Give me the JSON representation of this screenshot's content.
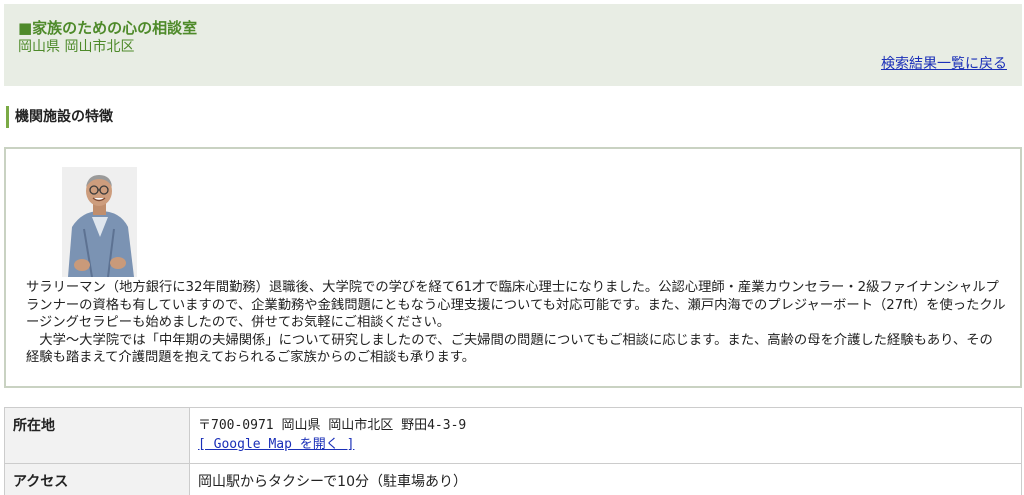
{
  "header": {
    "facility_name": "■家族のための心の相談室",
    "location": "岡山県 岡山市北区",
    "back_link": "検索結果一覧に戻る"
  },
  "features": {
    "heading": "機関施設の特徴",
    "paragraphs": [
      "サラリーマン（地方銀行に32年間勤務）退職後、大学院での学びを経て61才で臨床心理士になりました。公認心理師・産業カウンセラー・2級ファイナンシャルプランナーの資格も有していますので、企業勤務や金銭問題にともなう心理支援についても対応可能です。また、瀬戸内海でのプレジャーボート（27ft）を使ったクルージングセラピーも始めましたので、併せてお気軽にご相談ください。",
      "　大学～大学院では「中年期の夫婦関係」について研究しましたので、ご夫婦間の問題についてもご相談に応じます。また、高齢の母を介護した経験もあり、その経験も踏まえて介護問題を抱えておられるご家族からのご相談も承ります。"
    ]
  },
  "info": {
    "address_label": "所在地",
    "address": "〒700-0971 岡山県 岡山市北区 野田4-3-9",
    "map_link": "[ Google Map を開く ]",
    "access_label": "アクセス",
    "access": "岡山駅からタクシーで10分（駐車場あり）"
  }
}
